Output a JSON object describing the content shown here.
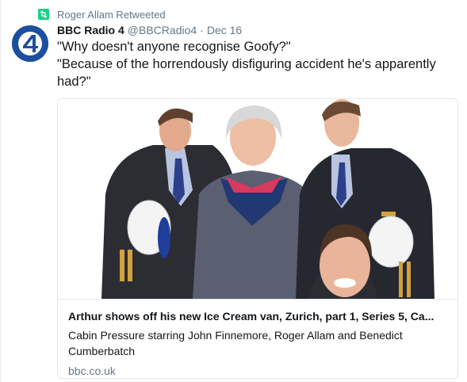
{
  "retweet": {
    "label": "Roger Allam Retweeted",
    "icon": "retweet-icon",
    "color": "#19cf86"
  },
  "author": {
    "name": "BBC Radio 4",
    "handle": "@BBCRadio4",
    "separator": "·",
    "time": "Dec 16",
    "avatar_icon": "bbc-radio-4-logo",
    "avatar_color": "#1d4fa0"
  },
  "tweet": {
    "line1": "\"Why doesn't anyone recognise Goofy?\"",
    "line2": "\"Because of the horrendously disfiguring accident he's apparently had?\""
  },
  "card": {
    "image_icon": "cast-photo",
    "title": "Arthur shows off his new Ice Cream van, Zurich, part 1, Series 5, Ca...",
    "description": "Cabin Pressure starring John Finnemore, Roger Allam and Benedict Cumberbatch",
    "domain": "bbc.co.uk"
  }
}
